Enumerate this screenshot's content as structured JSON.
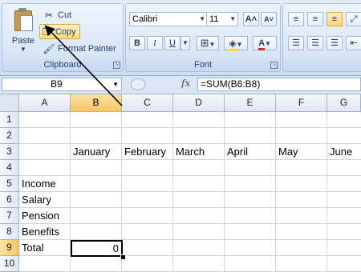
{
  "clipboard": {
    "group_label": "Clipboard",
    "paste_label": "Paste",
    "cut_label": "Cut",
    "copy_label": "Copy",
    "format_painter_label": "Format Painter"
  },
  "font": {
    "group_label": "Font",
    "font_name": "Calibri",
    "font_size": "11",
    "bold": "B",
    "italic": "I",
    "underline": "U",
    "grow": "A",
    "shrink": "A",
    "font_color": "A",
    "font_color_hex": "#d32a1e"
  },
  "formula_bar": {
    "name_box": "B9",
    "fx": "fx",
    "formula": "=SUM(B6:B8)"
  },
  "sheet": {
    "columns": [
      "A",
      "B",
      "C",
      "D",
      "E",
      "F",
      "G"
    ],
    "active_column": "B",
    "rows": [
      "1",
      "2",
      "3",
      "4",
      "5",
      "6",
      "7",
      "8",
      "9",
      "10"
    ],
    "active_row": "9",
    "months": [
      "January",
      "February",
      "March",
      "April",
      "May",
      "June"
    ],
    "labels": [
      "Income",
      "Salary",
      "Pension",
      "Benefits",
      "Total"
    ],
    "total_value": "0"
  }
}
